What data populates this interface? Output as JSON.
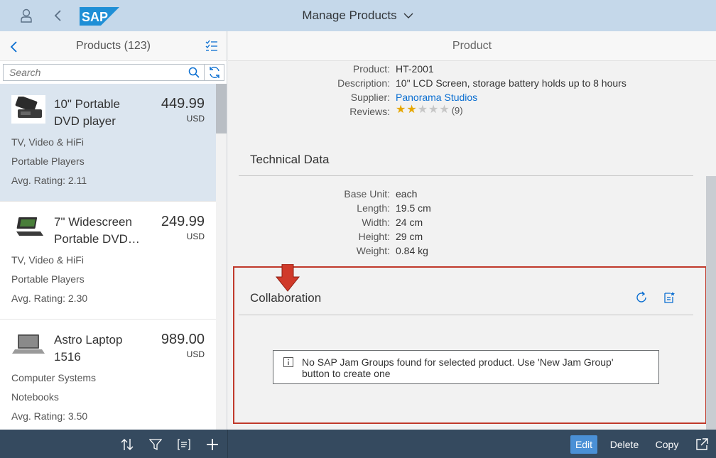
{
  "shell": {
    "title": "Manage Products",
    "logo_text": "SAP"
  },
  "master": {
    "title": "Products (123)",
    "search_placeholder": "Search",
    "items": [
      {
        "name": "10\" Portable DVD player",
        "price": "449.99",
        "currency": "USD",
        "category": "TV, Video & HiFi",
        "subcategory": "Portable Players",
        "rating": "Avg. Rating: 2.11"
      },
      {
        "name": "7\" Widescreen Portable DVD…",
        "price": "249.99",
        "currency": "USD",
        "category": "TV, Video & HiFi",
        "subcategory": "Portable Players",
        "rating": "Avg. Rating: 2.30"
      },
      {
        "name": "Astro Laptop 1516",
        "price": "989.00",
        "currency": "USD",
        "category": "Computer Systems",
        "subcategory": "Notebooks",
        "rating": "Avg. Rating: 3.50"
      }
    ]
  },
  "detail": {
    "title": "Product",
    "fields": {
      "product_label": "Product:",
      "product_value": "HT-2001",
      "description_label": "Description:",
      "description_value": "10\" LCD Screen, storage battery holds up to 8 hours",
      "supplier_label": "Supplier:",
      "supplier_value": "Panorama Studios",
      "reviews_label": "Reviews:",
      "reviews_count": "(9)",
      "reviews_rating": 2
    },
    "technical": {
      "title": "Technical Data",
      "base_unit_label": "Base Unit:",
      "base_unit_value": "each",
      "length_label": "Length:",
      "length_value": "19.5 cm",
      "width_label": "Width:",
      "width_value": "24 cm",
      "height_label": "Height:",
      "height_value": "29 cm",
      "weight_label": "Weight:",
      "weight_value": "0.84 kg"
    },
    "collaboration": {
      "title": "Collaboration",
      "message": "No SAP Jam Groups found for selected product. Use 'New Jam Group' button to create one"
    }
  },
  "footer": {
    "edit": "Edit",
    "delete": "Delete",
    "copy": "Copy"
  },
  "colors": {
    "shell_bg": "#c5d8ea",
    "footer_bg": "#354a5f",
    "link": "#0a6ed1",
    "highlight_border": "#c0392b",
    "star_on": "#e6a700"
  }
}
